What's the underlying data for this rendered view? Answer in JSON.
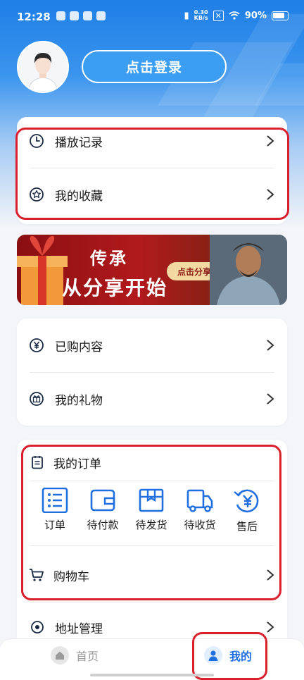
{
  "status_bar": {
    "time": "12:28",
    "net_speed_value": "0.30",
    "net_speed_unit": "KB/s",
    "battery": "90%"
  },
  "header": {
    "login_label": "点击登录"
  },
  "history_card": {
    "items": [
      {
        "label": "播放记录",
        "icon": "clock-icon"
      },
      {
        "label": "我的收藏",
        "icon": "star-icon"
      }
    ]
  },
  "banner": {
    "line1": "传承",
    "line2": "从分享开始",
    "button": "点击分享"
  },
  "purchase_card": {
    "items": [
      {
        "label": "已购内容",
        "icon": "yen-icon"
      },
      {
        "label": "我的礼物",
        "icon": "gift-icon"
      }
    ]
  },
  "orders": {
    "title": "我的订单",
    "icons": [
      {
        "label": "订单",
        "icon": "list-icon"
      },
      {
        "label": "待付款",
        "icon": "wallet-icon"
      },
      {
        "label": "待发货",
        "icon": "box-icon"
      },
      {
        "label": "待收货",
        "icon": "truck-icon"
      },
      {
        "label": "售后",
        "icon": "refund-icon"
      }
    ],
    "cart_label": "购物车"
  },
  "address": {
    "label": "地址管理"
  },
  "tabbar": {
    "home": "首页",
    "mine": "我的"
  },
  "colors": {
    "accent": "#1f6fe0",
    "highlight": "#d9202c"
  }
}
